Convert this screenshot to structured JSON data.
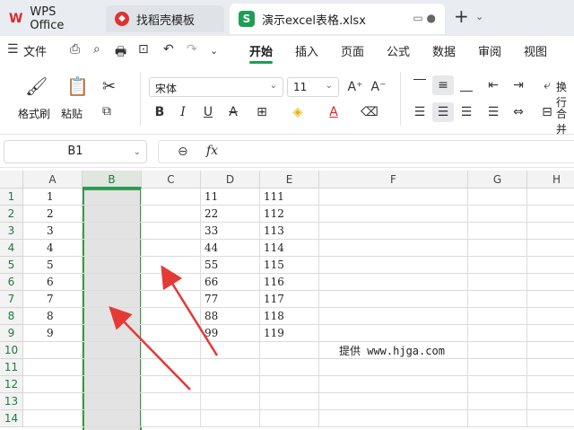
{
  "tabs": [
    {
      "label": "WPS Office",
      "icon": "wps-logo-icon"
    },
    {
      "label": "找稻壳模板",
      "icon": "docer-logo-icon"
    },
    {
      "label": "演示excel表格.xlsx",
      "icon": "spreadsheet-s-icon"
    }
  ],
  "menu": {
    "file": "文件",
    "items": [
      "开始",
      "插入",
      "页面",
      "公式",
      "数据",
      "审阅",
      "视图"
    ],
    "active": "开始"
  },
  "ribbon": {
    "format_painter": "格式刷",
    "paste": "粘贴",
    "font_name": "宋体",
    "font_size": "11",
    "wrap_text": "换行",
    "merge": "合并"
  },
  "formula_bar": {
    "name_box": "B1",
    "fx": "fx"
  },
  "grid": {
    "columns": [
      "A",
      "B",
      "C",
      "D",
      "E",
      "F",
      "G",
      "H"
    ],
    "rows": [
      "1",
      "2",
      "3",
      "4",
      "5",
      "6",
      "7",
      "8",
      "9",
      "10",
      "11",
      "12",
      "13",
      "14"
    ],
    "colA": [
      "1",
      "2",
      "3",
      "4",
      "5",
      "6",
      "7",
      "8",
      "9"
    ],
    "colD": [
      "11",
      "22",
      "33",
      "44",
      "55",
      "66",
      "77",
      "88",
      "99"
    ],
    "colE": [
      "111",
      "112",
      "113",
      "114",
      "115",
      "116",
      "117",
      "118",
      "119"
    ],
    "selected_column": "B",
    "credit_text": "提供 www.hjga.com"
  },
  "colors": {
    "accent": "#1f9d55",
    "arrow": "#e53935"
  }
}
